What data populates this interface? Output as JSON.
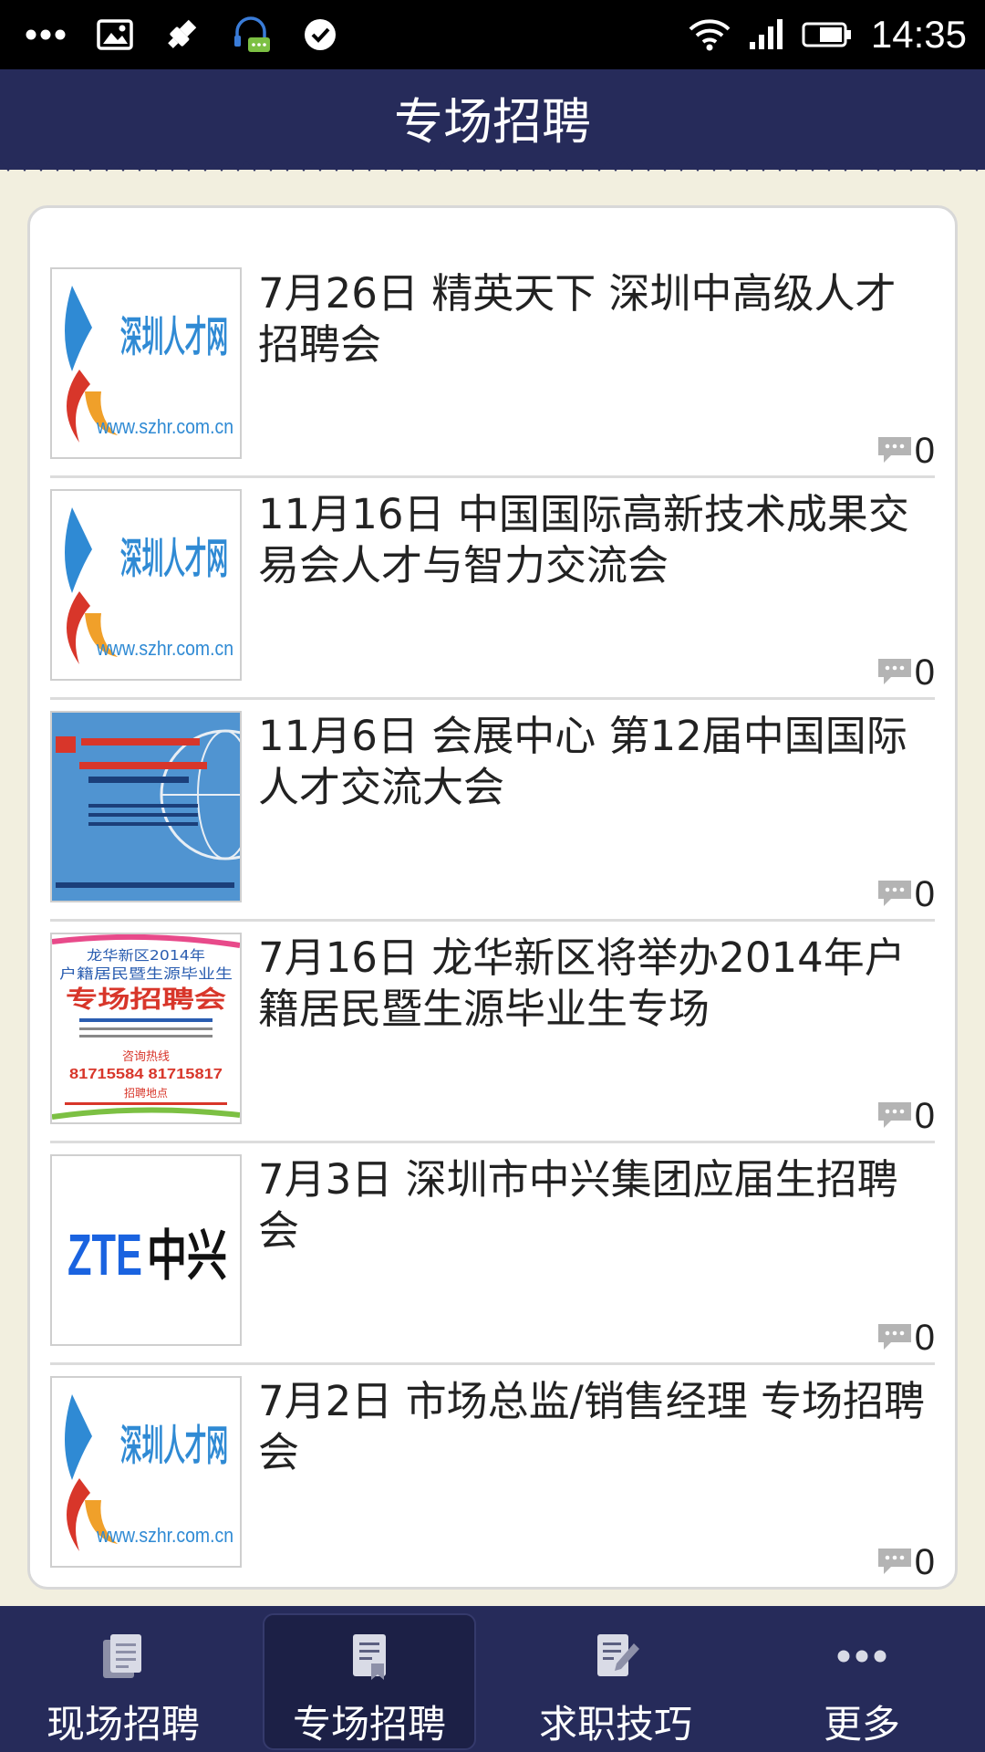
{
  "status_bar": {
    "time": "14:35",
    "left_icons": [
      "more-dots-icon",
      "image-icon",
      "usb-debug-icon",
      "headset-chat-icon",
      "check-circle-icon"
    ],
    "right_icons": [
      "wifi-icon",
      "signal-icon",
      "battery-icon"
    ]
  },
  "header": {
    "title": "专场招聘"
  },
  "list": {
    "items": [
      {
        "title": "7月26日  精英天下 深圳中高级人才招聘会",
        "comment_count": "0",
        "thumb": {
          "kind": "szhr",
          "brand": "深圳人才网",
          "url": "www.szhr.com.cn"
        }
      },
      {
        "title": "11月16日 中国国际高新技术成果交易会人才与智力交流会",
        "comment_count": "0",
        "thumb": {
          "kind": "szhr",
          "brand": "深圳人才网",
          "url": "www.szhr.com.cn"
        }
      },
      {
        "title": "11月6日 会展中心 第12届中国国际人才交流大会",
        "comment_count": "0",
        "thumb": {
          "kind": "poster-blue"
        }
      },
      {
        "title": "7月16日 龙华新区将举办2014年户籍居民暨生源毕业生专场",
        "comment_count": "0",
        "thumb": {
          "kind": "poster-white",
          "line1": "龙华新区2014年",
          "line2": "户籍居民暨生源毕业生",
          "line3": "专场招聘会",
          "phone_label": "咨询热线",
          "phones": "81715584   81715817",
          "place_label": "招聘地点"
        }
      },
      {
        "title": "7月3日 深圳市中兴集团应届生招聘会",
        "comment_count": "0",
        "thumb": {
          "kind": "zte",
          "brand_en": "ZTE",
          "brand_cn": "中兴"
        }
      },
      {
        "title": "7月2日 市场总监/销售经理 专场招聘会",
        "comment_count": "0",
        "thumb": {
          "kind": "szhr",
          "brand": "深圳人才网",
          "url": "www.szhr.com.cn"
        }
      }
    ]
  },
  "bottom_nav": {
    "items": [
      {
        "label": "现场招聘",
        "icon": "document-icon",
        "active": false
      },
      {
        "label": "专场招聘",
        "icon": "bookmark-document-icon",
        "active": true
      },
      {
        "label": "求职技巧",
        "icon": "edit-document-icon",
        "active": false
      },
      {
        "label": "更多",
        "icon": "more-dots-icon",
        "active": false
      }
    ]
  },
  "colors": {
    "header_bg": "#262b5a",
    "page_bg": "#f2efdf",
    "nav_active_bg": "#1c2046"
  }
}
